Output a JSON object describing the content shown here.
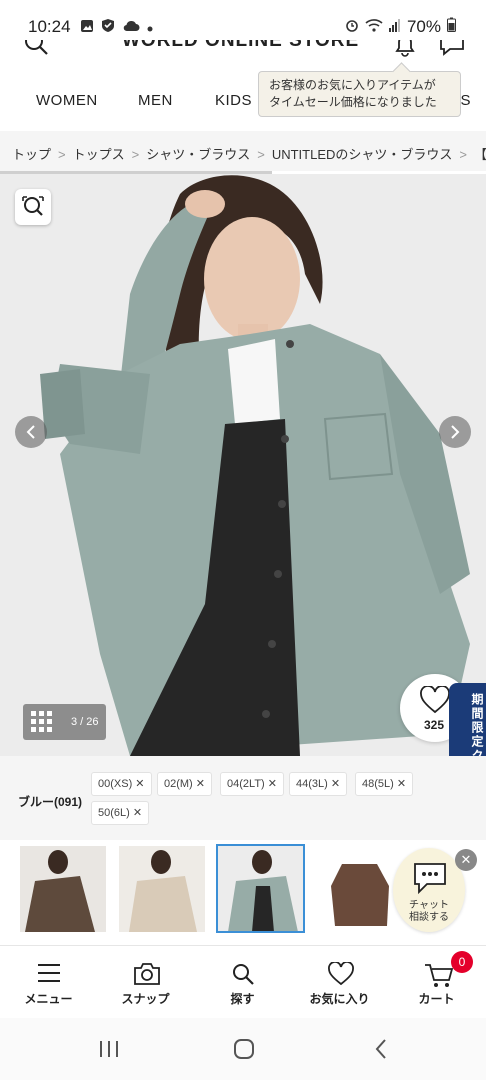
{
  "status_bar": {
    "time": "10:24",
    "battery": "70%"
  },
  "header": {
    "logo": "WORLD ONLINE STORE"
  },
  "nav": {
    "items": [
      "WOMEN",
      "MEN",
      "KIDS",
      "ES"
    ]
  },
  "tooltip": {
    "line1": "お客様のお気に入りアイテムが",
    "line2": "タイムセール価格になりました"
  },
  "breadcrumb": [
    "トップ",
    "トップス",
    "シャツ・ブラウス",
    "UNTITLEDのシャツ・ブラウス",
    "【シーズ"
  ],
  "gallery": {
    "counter": "3 / 26"
  },
  "favorite": {
    "count": "325"
  },
  "coupon_tab": {
    "label": "期間限定クーポン"
  },
  "product": {
    "color_label": "ブルー(091)",
    "sizes": [
      "00(XS)",
      "02(M)",
      "04(2LT)",
      "44(3L)",
      "48(5L)",
      "50(6L)"
    ]
  },
  "chat": {
    "line1": "チャット",
    "line2": "相談する"
  },
  "tabbar": {
    "items": [
      "メニュー",
      "スナップ",
      "探す",
      "お気に入り",
      "カート"
    ],
    "cart_badge": "0"
  },
  "colors": {
    "accent_blue": "#1b3b78",
    "badge_red": "#e4002b",
    "selected_thumb_border": "#3b8fd6"
  }
}
